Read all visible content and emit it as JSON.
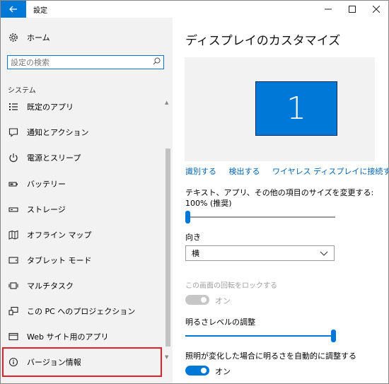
{
  "window": {
    "title": "設定",
    "back_icon": "arrow-left-icon"
  },
  "controls": {
    "minimize": "—",
    "maximize": "☐",
    "close": "✕"
  },
  "sidebar": {
    "home": {
      "label": "ホーム",
      "icon": "gear-icon"
    },
    "search_placeholder": "設定の検索",
    "section": "システム",
    "items": [
      {
        "label": "既定のアプリ",
        "icon": "default-apps-icon"
      },
      {
        "label": "通知とアクション",
        "icon": "notification-icon"
      },
      {
        "label": "電源とスリープ",
        "icon": "power-icon"
      },
      {
        "label": "バッテリー",
        "icon": "battery-icon"
      },
      {
        "label": "ストレージ",
        "icon": "storage-icon"
      },
      {
        "label": "オフライン マップ",
        "icon": "map-icon"
      },
      {
        "label": "タブレット モード",
        "icon": "tablet-icon"
      },
      {
        "label": "マルチタスク",
        "icon": "multitask-icon"
      },
      {
        "label": "この PC へのプロジェクション",
        "icon": "projection-icon"
      },
      {
        "label": "Web サイト用のアプリ",
        "icon": "web-apps-icon"
      },
      {
        "label": "バージョン情報",
        "icon": "info-icon",
        "highlighted": true
      }
    ],
    "highlight_color": "#e51e2a"
  },
  "main": {
    "title": "ディスプレイのカスタマイズ",
    "monitor_number": "1",
    "links": [
      "識別する",
      "検出する",
      "ワイヤレス ディスプレイに接続する"
    ],
    "scale_label": "テキスト、アプリ、その他の項目のサイズを変更する: 100% (推奨)",
    "scale_level": 0,
    "orientation_label": "向き",
    "orientation_value": "横",
    "rotation_lock_label": "この画面の回転をロックする",
    "rotation_lock_state": "オン",
    "brightness_label": "明るさレベルの調整",
    "brightness_level": 100,
    "auto_brightness_label": "照明が変化した場合に明るさを自動的に調整する",
    "auto_brightness_state": "オン",
    "accent_color": "#0078d7"
  }
}
